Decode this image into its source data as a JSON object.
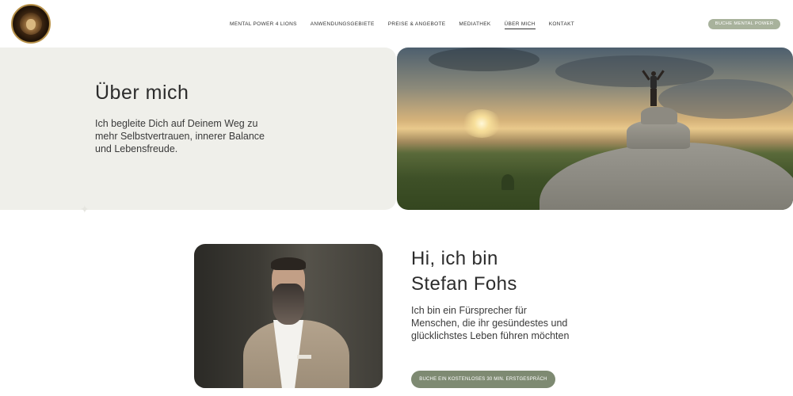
{
  "header": {
    "nav": [
      {
        "label": "MENTAL POWER 4 LIONS",
        "active": false
      },
      {
        "label": "ANWENDUNGSGEBIETE",
        "active": false
      },
      {
        "label": "PREISE & ANGEBOTE",
        "active": false
      },
      {
        "label": "MEDIATHEK",
        "active": false
      },
      {
        "label": "ÜBER MICH",
        "active": true
      },
      {
        "label": "KONTAKT",
        "active": false
      }
    ],
    "cta_label": "BUCHE MENTAL POWER"
  },
  "hero": {
    "title": "Über mich",
    "text": "Ich begleite Dich auf Deinem Weg zu mehr Selbstvertrauen, innerer Balance und Lebensfreude."
  },
  "intro": {
    "title_line1": "Hi, ich bin",
    "title_line2": "Stefan Fohs",
    "text": "Ich bin ein Fürsprecher für Menschen, die ihr gesündestes und glücklichstes Leben führen möchten",
    "cta_label": "BUCHE EIN KOSTENLOSES 30 MIN. ERSTGESPRÄCH"
  },
  "colors": {
    "accent": "#a8b29c",
    "cta_dark": "#7e8a72",
    "hero_bg": "#efefea"
  }
}
